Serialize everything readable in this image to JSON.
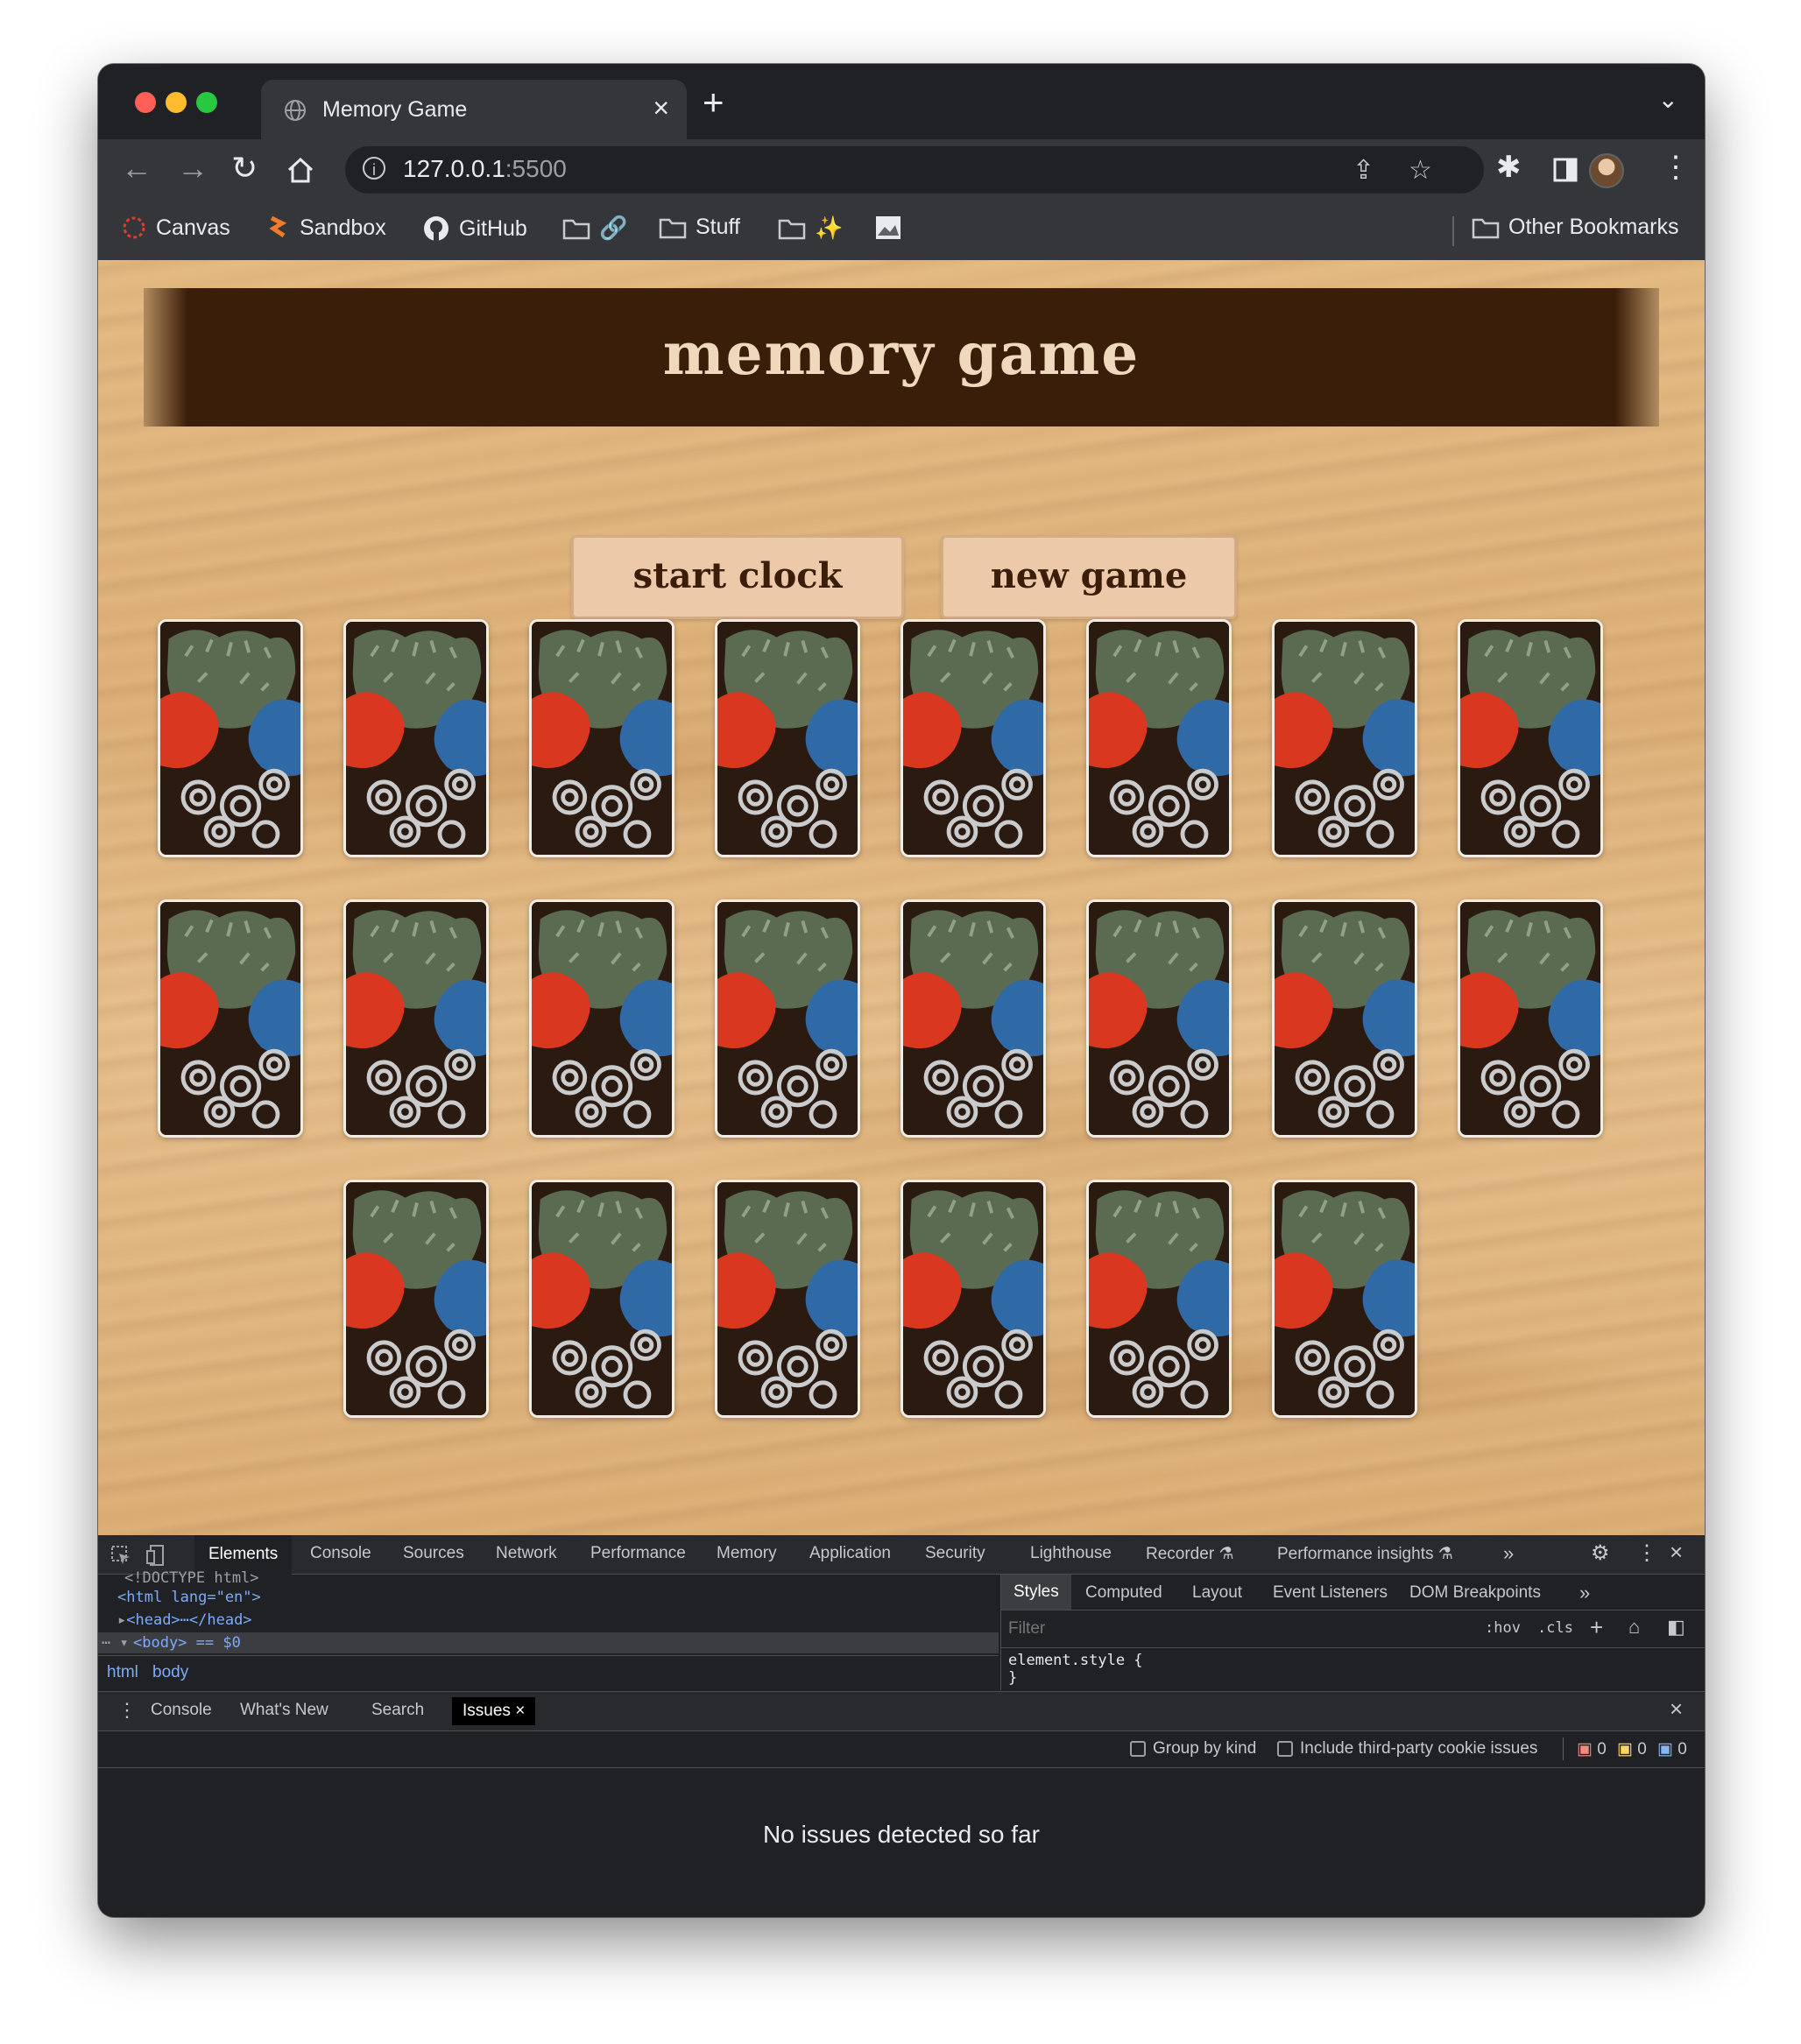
{
  "browser": {
    "tab_title": "Memory Game",
    "url_host": "127.0.0.1",
    "url_port": ":5500",
    "bookmarks": [
      "Canvas",
      "Sandbox",
      "GitHub",
      "Stuff"
    ],
    "other_bookmarks": "Other Bookmarks"
  },
  "game": {
    "title": "memory game",
    "start_button": "start clock",
    "new_game_button": "new game",
    "card_count": 22,
    "card_rows": [
      8,
      8,
      6
    ]
  },
  "devtools": {
    "tabs": [
      "Elements",
      "Console",
      "Sources",
      "Network",
      "Performance",
      "Memory",
      "Application",
      "Security",
      "Lighthouse",
      "Recorder",
      "Performance insights"
    ],
    "active_tab": "Elements",
    "dom_lines": [
      "<!DOCTYPE html>",
      "<html lang=\"en\">",
      "<head>⋯</head>",
      "<body> == $0"
    ],
    "breadcrumbs": [
      "html",
      "body"
    ],
    "styles_tabs": [
      "Styles",
      "Computed",
      "Layout",
      "Event Listeners",
      "DOM Breakpoints"
    ],
    "filter_placeholder": "Filter",
    "hov": ":hov",
    "cls": ".cls",
    "element_style": "element.style {",
    "element_style_close": "}",
    "drawer_tabs": [
      "Console",
      "What's New",
      "Search",
      "Issues"
    ],
    "active_drawer_tab": "Issues",
    "group_by_kind": "Group by kind",
    "third_party": "Include third-party cookie issues",
    "counts": [
      "0",
      "0",
      "0"
    ],
    "no_issues": "No issues detected so far"
  },
  "colors": {
    "banner": "#3b1e0a",
    "title_text": "#f0d8bd",
    "button_bg": "#ecc9a8",
    "card_red": "#d9371f",
    "card_blue": "#2f6aa6",
    "card_green": "#5a6b52"
  }
}
